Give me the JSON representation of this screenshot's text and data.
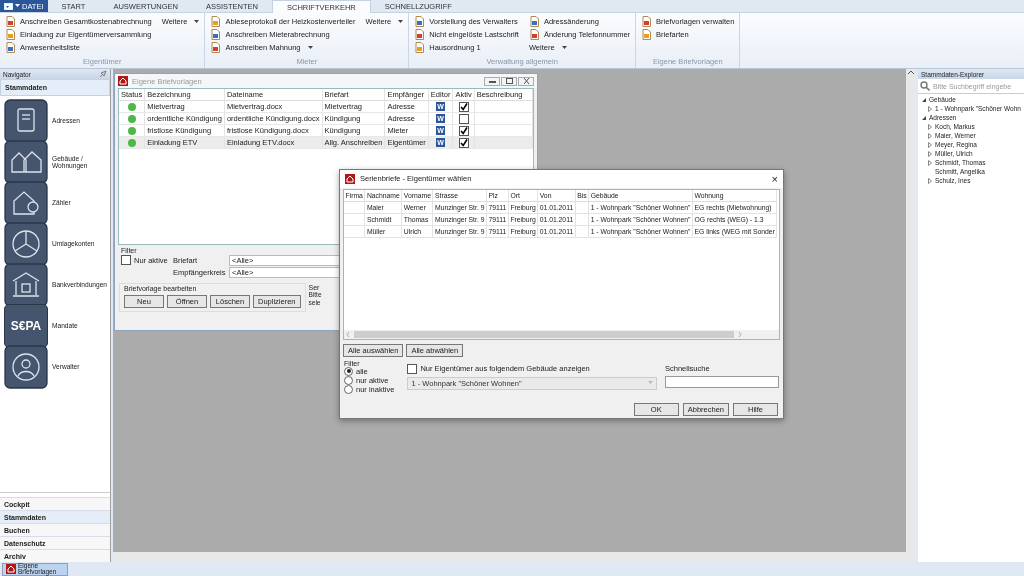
{
  "menu_tabs": [
    {
      "label": "DATEI",
      "kind": "file",
      "selected": false
    },
    {
      "label": "START",
      "kind": "tab",
      "selected": false
    },
    {
      "label": "AUSWERTUNGEN",
      "kind": "tab",
      "selected": false
    },
    {
      "label": "ASSISTENTEN",
      "kind": "tab",
      "selected": false
    },
    {
      "label": "SCHRIFTVERKEHR",
      "kind": "tab",
      "selected": true
    },
    {
      "label": "SCHNELLZUGRIFF",
      "kind": "tab",
      "selected": false
    }
  ],
  "ribbon": [
    {
      "label": "Eigentümer",
      "columns": [
        [
          {
            "label": "Anschreiben Gesamtkostenabrechnung",
            "has_icon": true,
            "dropdown": false
          },
          {
            "label": "Einladung zur Eigentümerversammlung",
            "has_icon": true,
            "dropdown": false
          },
          {
            "label": "Anwesenheitsliste",
            "has_icon": true,
            "dropdown": false
          }
        ],
        [
          {
            "label": "Weitere",
            "has_icon": false,
            "dropdown": true
          }
        ]
      ]
    },
    {
      "label": "Mieter",
      "columns": [
        [
          {
            "label": "Ableseprotokoll der Heizkostenverteiler",
            "has_icon": true,
            "dropdown": false
          },
          {
            "label": "Anschreiben Mieterabrechnung",
            "has_icon": true,
            "dropdown": false
          },
          {
            "label": "Anschreiben Mahnung",
            "has_icon": true,
            "dropdown": true
          }
        ],
        [
          {
            "label": "Weitere",
            "has_icon": false,
            "dropdown": true
          }
        ]
      ]
    },
    {
      "label": "Verwaltung allgemein",
      "columns": [
        [
          {
            "label": "Vorstellung des Verwalters",
            "has_icon": true,
            "dropdown": false
          },
          {
            "label": "Nicht eingelöste Lastschrift",
            "has_icon": true,
            "dropdown": false
          },
          {
            "label": "Hausordnung 1",
            "has_icon": true,
            "dropdown": false
          }
        ],
        [
          {
            "label": "Adressänderung",
            "has_icon": true,
            "dropdown": false
          },
          {
            "label": "Änderung Telefonnummer",
            "has_icon": true,
            "dropdown": false
          },
          {
            "label": "Weitere",
            "has_icon": false,
            "dropdown": true
          }
        ]
      ]
    },
    {
      "label": "Eigene Briefvorlagen",
      "columns": [
        [
          {
            "label": "Briefvorlagen verwalten",
            "has_icon": true,
            "dropdown": false
          },
          {
            "label": "Briefarten",
            "has_icon": true,
            "dropdown": false
          }
        ]
      ]
    }
  ],
  "navigator": {
    "title": "Navigator",
    "section": "Stammdaten",
    "items": [
      {
        "label": "Adressen"
      },
      {
        "label": "Gebäude /\nWohnungen"
      },
      {
        "label": "Zähler"
      },
      {
        "label": "Umlagekonten"
      },
      {
        "label": "Bankverbindungen"
      },
      {
        "label": "Mandate",
        "icon_text": "S€PA"
      },
      {
        "label": "Verwalter"
      }
    ],
    "sections": [
      {
        "label": "Cockpit",
        "selected": false
      },
      {
        "label": "Stammdaten",
        "selected": true
      },
      {
        "label": "Buchen",
        "selected": false
      },
      {
        "label": "Datenschutz",
        "selected": false
      },
      {
        "label": "Archiv",
        "selected": false
      }
    ]
  },
  "templates_window": {
    "title": "Eigene Briefvorlagen",
    "columns": [
      "Status",
      "Bezeichnung",
      "Dateiname",
      "Briefart",
      "Empfänger",
      "Editor",
      "Aktiv",
      "Beschreibung"
    ],
    "rows": [
      {
        "color": "#4cb848",
        "name": "Mietvertrag",
        "file": "Mietvertrag.docx",
        "type": "Mietvertrag",
        "recipient": "Adresse",
        "editor": "W",
        "active": true,
        "selected": false
      },
      {
        "color": "#4cb848",
        "name": "ordentliche Kündigung",
        "file": "ordentliche Kündigung.docx",
        "type": "Kündigung",
        "recipient": "Adresse",
        "editor": "W",
        "active": false,
        "selected": false
      },
      {
        "color": "#4cb848",
        "name": "fristlose Kündigung",
        "file": "fristlose Kündigung.docx",
        "type": "Kündigung",
        "recipient": "Mieter",
        "editor": "W",
        "active": true,
        "selected": false
      },
      {
        "color": "#4cb848",
        "name": "Einladung ETV",
        "file": "Einladung ETV.docx",
        "type": "Allg. Anschreiben",
        "recipient": "Eigentümer",
        "editor": "W",
        "active": true,
        "selected": true
      }
    ],
    "filter": {
      "label": "Filter",
      "only_active": {
        "label": "Nur aktive",
        "checked": false
      },
      "type_label": "Briefart",
      "type_value": "<Alle>",
      "recipient_label": "Empfängerkreis",
      "recipient_value": "<Alle>"
    },
    "edit_group": {
      "label": "Briefvorlage bearbeiten",
      "buttons": [
        "Neu",
        "Öffnen",
        "Löschen",
        "Duplizieren"
      ]
    },
    "series_group": {
      "label": "Ser",
      "lines": [
        "Bitte",
        "sele"
      ]
    }
  },
  "dialog": {
    "title": "Serienbriefe - Eigentümer wählen",
    "close": "×",
    "columns": [
      "Firma",
      "Nachname",
      "Vorname",
      "Strasse",
      "Plz",
      "Ort",
      "Von",
      "Bis",
      "Gebäude",
      "Wohnung"
    ],
    "rows": [
      [
        "",
        "Maier",
        "Werner",
        "Munzinger Str. 9",
        "79111",
        "Freiburg",
        "01.01.2011",
        "",
        "1 - Wohnpark \"Schöner Wohnen\"",
        "EG rechts (Mietwohnung)"
      ],
      [
        "",
        "Schmidt",
        "Thomas",
        "Munzinger Str. 9",
        "79111",
        "Freiburg",
        "01.01.2011",
        "",
        "1 - Wohnpark \"Schöner Wohnen\"",
        "OG rechts (WEG) - 1.3"
      ],
      [
        "",
        "Müller",
        "Ulrich",
        "Munzinger Str. 9",
        "79111",
        "Freiburg",
        "01.01.2011",
        "",
        "1 - Wohnpark \"Schöner Wohnen\"",
        "EG links (WEG mit Sonder"
      ]
    ],
    "select_buttons": [
      "Alle auswählen",
      "Alle abwählen"
    ],
    "filter": {
      "label": "Filter",
      "options": [
        {
          "label": "alle",
          "selected": true
        },
        {
          "label": "nur aktive",
          "selected": false
        },
        {
          "label": "nur inaktive",
          "selected": false
        }
      ]
    },
    "building_filter": {
      "label": "Nur Eigentümer aus folgendem Gebäude anzeigen",
      "checked": false,
      "value": "1 - Wohnpark \"Schöner Wohnen\"",
      "disabled": true
    },
    "quick_search": {
      "label": "Schnellsuche"
    },
    "buttons": [
      "OK",
      "Abbrechen",
      "Hilfe"
    ]
  },
  "explorer": {
    "title": "Stammdaten-Explorer",
    "search": {
      "placeholder": "Bitte Suchbegriff eingebe"
    },
    "tree": [
      {
        "label": "Gebäude",
        "expanded": true,
        "children": [
          {
            "label": "1 - Wohnpark \"Schöner Wohn",
            "expandable": true
          }
        ]
      },
      {
        "label": "Adressen",
        "expanded": true,
        "children": [
          {
            "label": "Koch, Markus",
            "expandable": true
          },
          {
            "label": "Maier, Werner",
            "expandable": true
          },
          {
            "label": "Meyer, Regina",
            "expandable": true
          },
          {
            "label": "Müller, Ulrich",
            "expandable": true
          },
          {
            "label": "Schmidt, Thomas",
            "expandable": true
          },
          {
            "label": "Schmitt, Angelika",
            "expandable": false
          },
          {
            "label": "Schulz, Ines",
            "expandable": true
          }
        ]
      }
    ]
  },
  "taskbar": [
    {
      "label": "Eigene Briefvorlagen",
      "selected": true
    }
  ]
}
